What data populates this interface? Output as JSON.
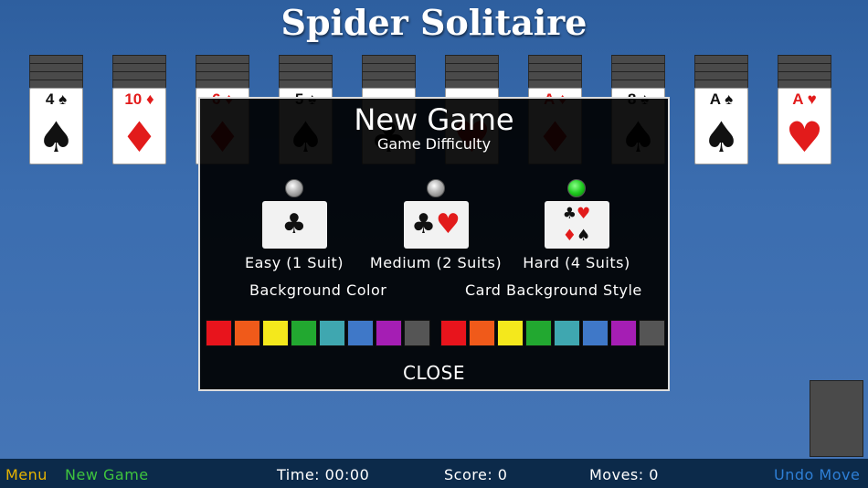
{
  "title": "Spider Solitaire",
  "columns": [
    {
      "rank": "4",
      "suit": "♠",
      "color": "blk"
    },
    {
      "rank": "10",
      "suit": "♦",
      "color": "red"
    },
    {
      "rank": "6",
      "suit": "♦",
      "color": "red"
    },
    {
      "rank": "5",
      "suit": "♠",
      "color": "blk"
    },
    {
      "rank": "",
      "suit": "♣",
      "color": "blk"
    },
    {
      "rank": "",
      "suit": "♥",
      "color": "red"
    },
    {
      "rank": "A",
      "suit": "♦",
      "color": "red"
    },
    {
      "rank": "8",
      "suit": "♠",
      "color": "blk"
    },
    {
      "rank": "A",
      "suit": "♠",
      "color": "blk"
    },
    {
      "rank": "A",
      "suit": "♥",
      "color": "red"
    }
  ],
  "modal": {
    "title": "New Game",
    "subtitle": "Game Difficulty",
    "difficulties": [
      {
        "label": "Easy (1 Suit)",
        "selected": false
      },
      {
        "label": "Medium (2 Suits)",
        "selected": false
      },
      {
        "label": "Hard (4 Suits)",
        "selected": true
      }
    ],
    "background_color_label": "Background Color",
    "card_background_label": "Card Background Style",
    "colors": [
      "#e8141c",
      "#f05a1a",
      "#f4e81c",
      "#22a830",
      "#3fa7b0",
      "#3f78c8",
      "#a51eb4",
      "#555555"
    ],
    "close_label": "CLOSE"
  },
  "bottom": {
    "menu": "Menu",
    "new_game": "New Game",
    "time": "Time: 00:00",
    "score": "Score: 0",
    "moves": "Moves: 0",
    "undo": "Undo Move",
    "menu_color": "#e8b400",
    "new_game_color": "#3ec43e",
    "undo_color": "#2e7fd6"
  }
}
